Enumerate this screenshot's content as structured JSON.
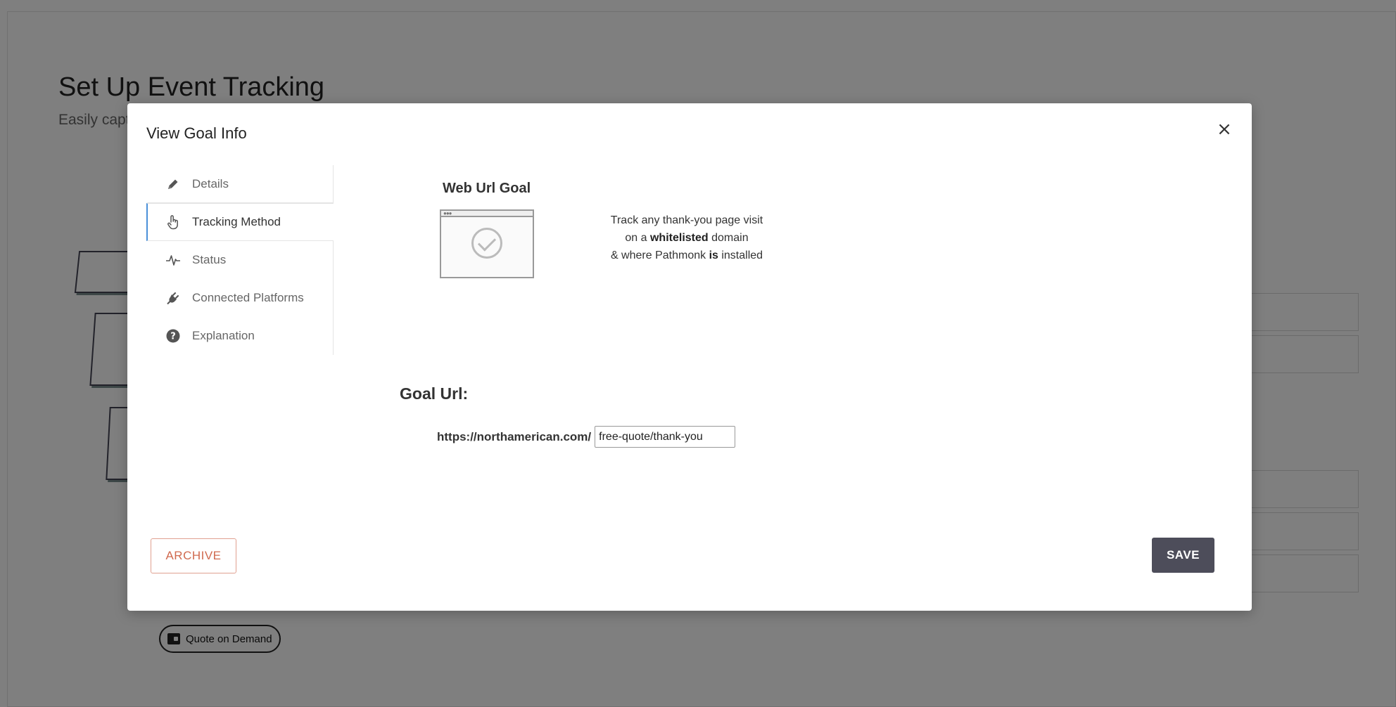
{
  "background": {
    "page_title": "Set Up Event Tracking",
    "page_subtitle": "Easily captu",
    "chip_label": "Quote on Demand"
  },
  "modal": {
    "title": "View Goal Info",
    "close_symbol": "×",
    "nav": {
      "items": [
        {
          "label": "Details",
          "icon": "pencil-icon"
        },
        {
          "label": "Tracking Method",
          "icon": "hand-pointer-icon",
          "active": true
        },
        {
          "label": "Status",
          "icon": "heartbeat-icon"
        },
        {
          "label": "Connected Platforms",
          "icon": "plug-icon"
        },
        {
          "label": "Explanation",
          "icon": "question-circle-icon"
        }
      ]
    },
    "goal_type": {
      "title": "Web Url Goal",
      "description_line1": "Track any thank-you page visit",
      "description_line2_pre": "on a ",
      "description_line2_bold": "whitelisted",
      "description_line2_post": " domain",
      "description_line3_pre": "& where Pathmonk ",
      "description_line3_bold": "is",
      "description_line3_post": " installed"
    },
    "goal_url": {
      "heading": "Goal Url:",
      "prefix": "https://northamerican.com/",
      "value": "free-quote/thank-you"
    },
    "buttons": {
      "archive": "ARCHIVE",
      "save": "SAVE"
    }
  }
}
